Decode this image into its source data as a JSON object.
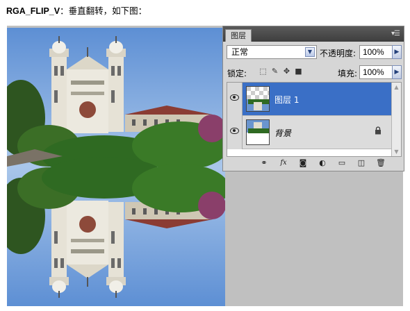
{
  "heading": {
    "code": "RGA_FLIP_V",
    "rest": "：垂直翻转，如下图："
  },
  "photo": {
    "description_icon": "flipped-church-photo",
    "sky_color": "#6f9ad6",
    "foliage_color": "#2f6a22"
  },
  "layers_panel": {
    "tab_label": "图层",
    "blend_mode": "正常",
    "opacity_label": "不透明度:",
    "opacity_value": "100%",
    "lock_label": "锁定:",
    "fill_label": "填充:",
    "fill_value": "100%",
    "layers": [
      {
        "name": "图层 1",
        "selected": true
      },
      {
        "name": "背景",
        "selected": false,
        "locked": true
      }
    ],
    "toolbar_icons": [
      "link-icon",
      "fx-icon",
      "mask-icon",
      "adjustment-icon",
      "group-icon",
      "new-layer-icon",
      "trash-icon"
    ],
    "selection_color": "#3a6fc6"
  }
}
